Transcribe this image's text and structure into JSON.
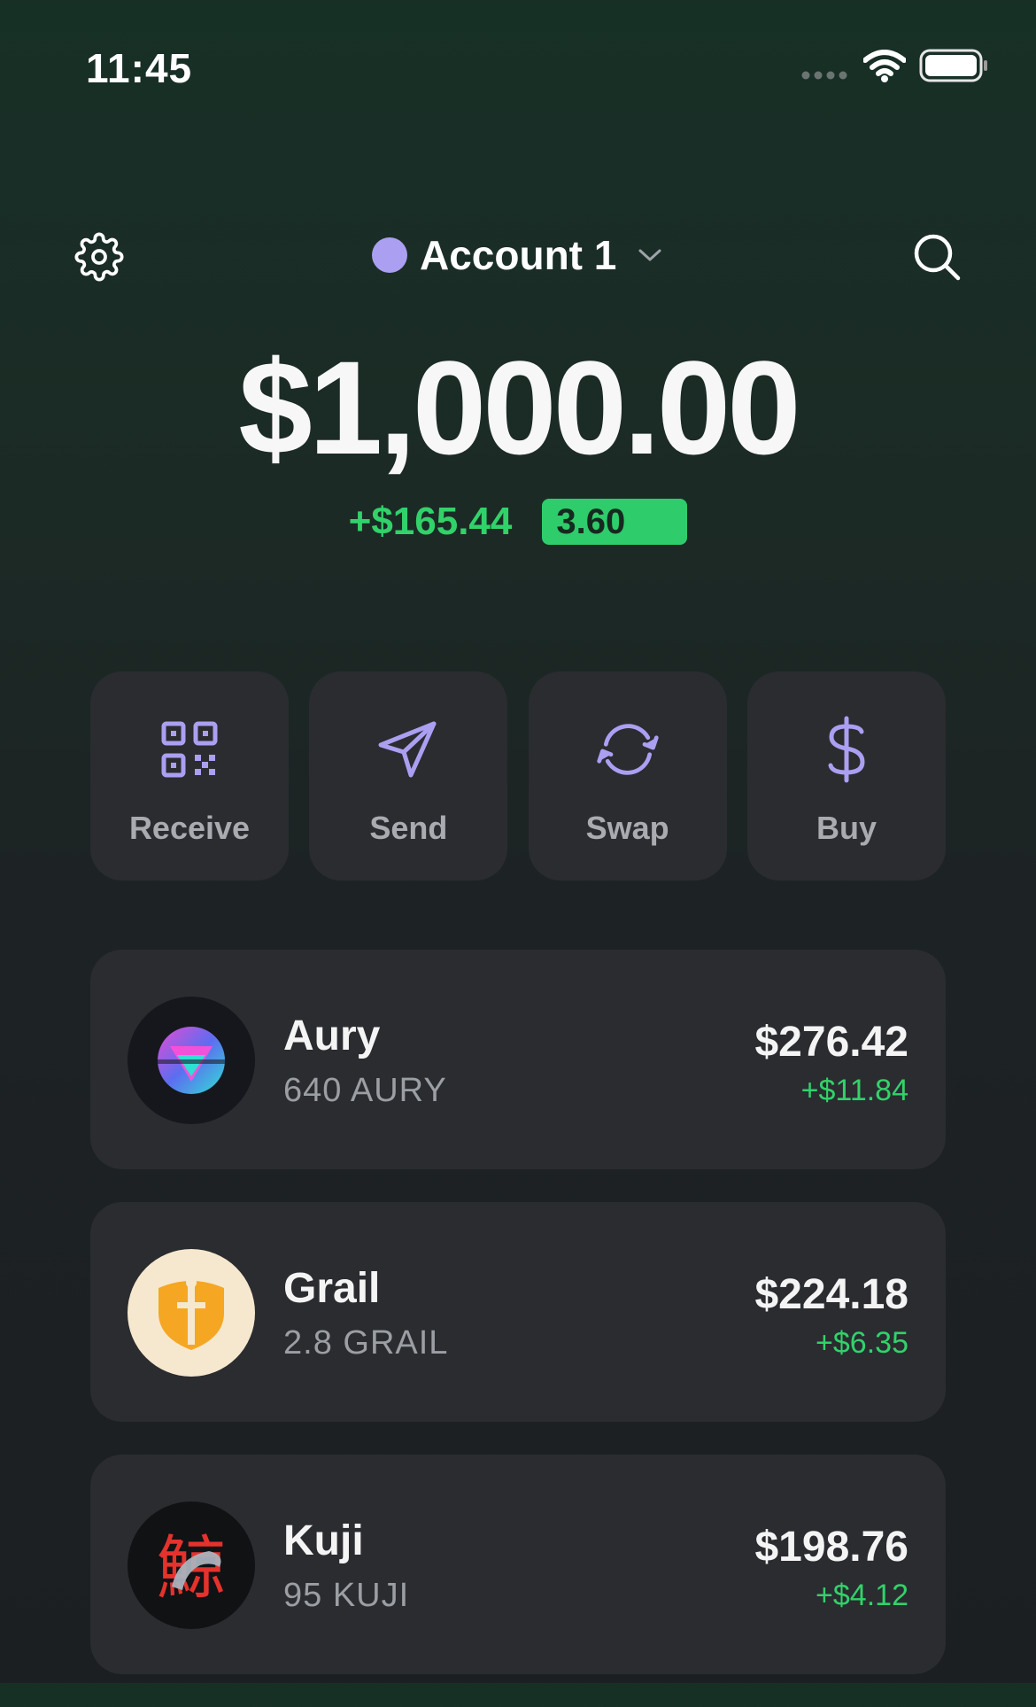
{
  "status_bar": {
    "time": "11:45"
  },
  "header": {
    "account_name": "Account 1",
    "account_color": "#ab9ff2"
  },
  "balance": {
    "total": "$1,000.00",
    "change_value": "+$165.44",
    "change_badge": "3.60"
  },
  "actions": [
    {
      "label": "Receive",
      "icon": "qr-code-icon"
    },
    {
      "label": "Send",
      "icon": "send-icon"
    },
    {
      "label": "Swap",
      "icon": "swap-icon"
    },
    {
      "label": "Buy",
      "icon": "dollar-icon"
    }
  ],
  "tokens": [
    {
      "name": "Aury",
      "amount": "640 AURY",
      "value": "$276.42",
      "change": "+$11.84"
    },
    {
      "name": "Grail",
      "amount": "2.8 GRAIL",
      "value": "$224.18",
      "change": "+$6.35"
    },
    {
      "name": "Kuji",
      "amount": "95 KUJI",
      "value": "$198.76",
      "change": "+$4.12"
    }
  ],
  "colors": {
    "accent": "#ab9ff2",
    "positive": "#32d26a",
    "card": "#2a2c30"
  }
}
